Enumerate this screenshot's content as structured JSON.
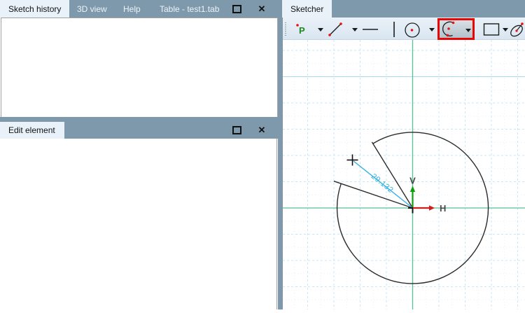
{
  "history_panel": {
    "tabs": [
      {
        "label": "Sketch history",
        "active": true
      },
      {
        "label": "3D view",
        "active": false
      },
      {
        "label": "Help",
        "active": false
      },
      {
        "label": "Table - test1.tab",
        "active": false
      }
    ]
  },
  "edit_panel": {
    "title": "Edit element"
  },
  "sketcher_panel": {
    "tab": "Sketcher"
  },
  "icons": {
    "close": "✕",
    "point_glyph": "P"
  },
  "toolbar": {
    "tools": [
      {
        "name": "point-tool",
        "dropdown": true
      },
      {
        "name": "line-tool",
        "dropdown": true
      },
      {
        "name": "horizontal-line-tool",
        "dropdown": false
      },
      {
        "name": "vertical-line-tool",
        "dropdown": false
      },
      {
        "name": "circle-tool",
        "dropdown": true
      },
      {
        "name": "arc-tool",
        "dropdown": true,
        "selected": true,
        "highlighted": true
      },
      {
        "name": "rectangle-tool",
        "dropdown": true
      },
      {
        "name": "ellipse-tool",
        "dropdown": false
      }
    ],
    "highlight_color": "#ea0505"
  },
  "canvas": {
    "origin": [
      589.5,
      297
    ],
    "radius": 108,
    "arc": {
      "start_angle_deg": 121.7,
      "end_angle_deg": 161.2
    },
    "radius_lines": [
      {
        "angle_deg": 121.7,
        "length": 110.5
      },
      {
        "angle_deg": 161.2,
        "length": 119
      }
    ],
    "cursor": [
      503.5,
      228.5
    ],
    "dimension": {
      "value": "29.132",
      "rotation_deg": 38.5
    },
    "axis_labels": {
      "h": "H",
      "v": "V"
    },
    "grid": {
      "minor_step": 18.75,
      "strong_step": 37.5,
      "major_step": 187.5
    },
    "colors": {
      "axis": "#52c392",
      "dimension": "#33b1e6",
      "geometry": "#2b2b2b",
      "h_arrow": "#d11c1c",
      "v_arrow": "#0ba00b",
      "grid_major": "#a8d9f1",
      "grid_strong": "#c9e7f6",
      "grid_faint": "#e1f1fa"
    }
  }
}
